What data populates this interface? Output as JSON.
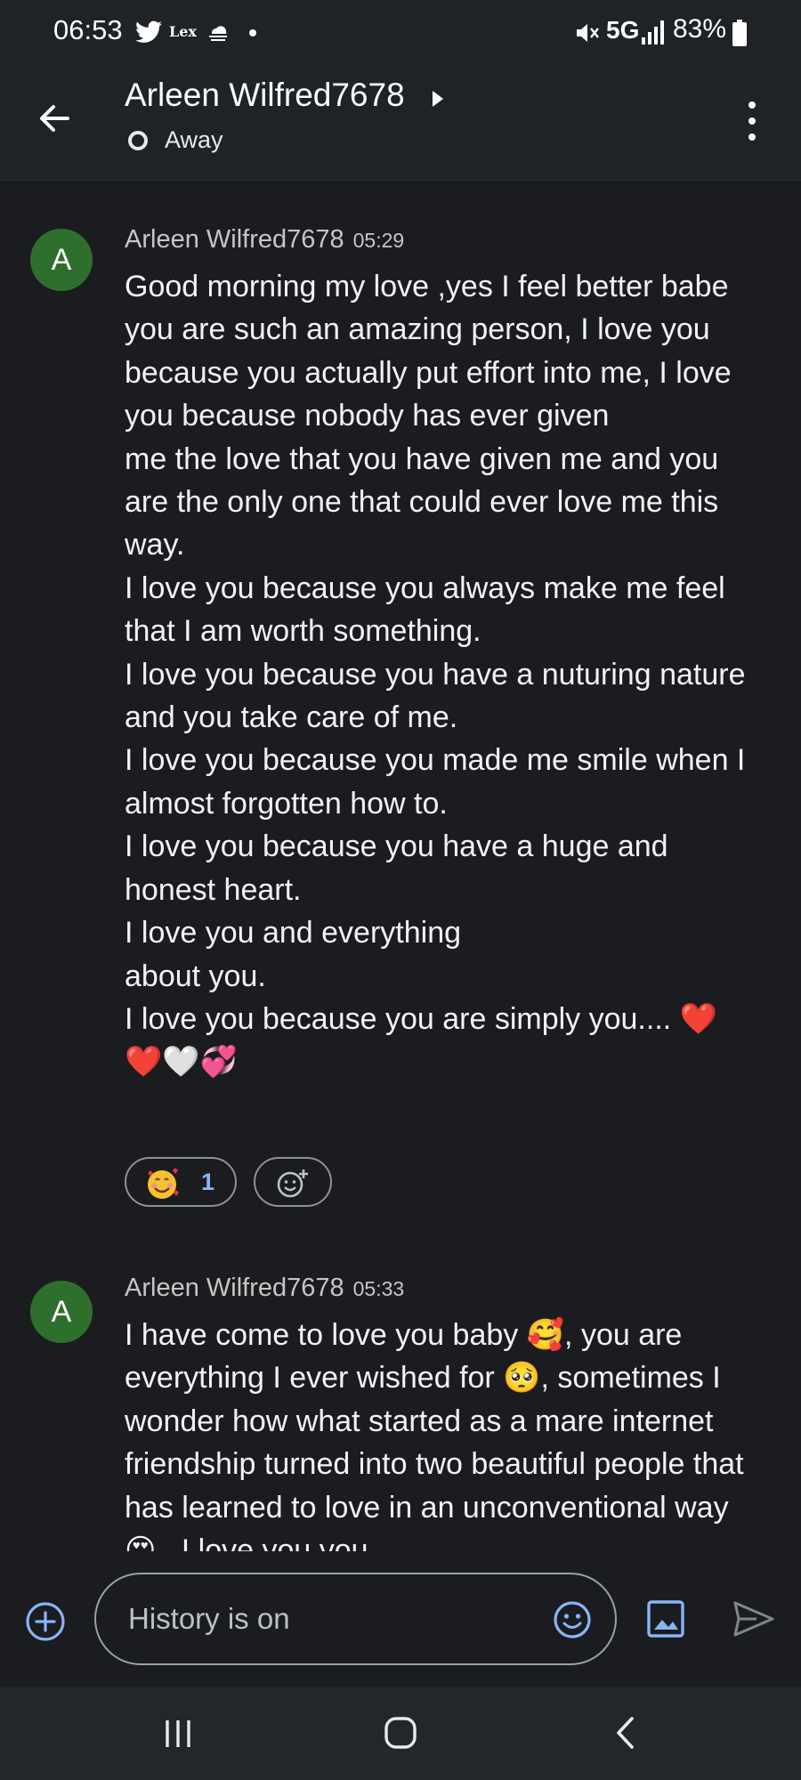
{
  "status_bar": {
    "time": "06:53",
    "carrier_text": "Lex",
    "network": "5G",
    "battery": "83%",
    "icons": [
      "twitter-bird-icon",
      "cloud-icon",
      "dot-icon",
      "mute-icon",
      "signal-icon",
      "battery-icon"
    ]
  },
  "app_bar": {
    "contact_name": "Arleen Wilfred7678",
    "presence": "Away",
    "icons": [
      "back-arrow-icon",
      "caret-right-icon",
      "presence-circle-icon",
      "overflow-menu-icon"
    ]
  },
  "messages": [
    {
      "avatar_letter": "A",
      "sender": "Arleen Wilfred7678",
      "time": "05:29",
      "text": "Good morning my love ,yes I feel better babe you are such an amazing person, I love you because you actually put effort into me, I love you because nobody has ever given\nme the love that you have given me and you are the only one that could ever love me this way.\nI love you because you always make me feel that I am worth something.\nI love you because you have a nuturing nature and you take care of me.\nI love you because you made me smile when I almost forgotten how to.\nI love you because you have a huge and honest heart.\nI love you and everything\nabout you.\nI love you because you are simply you.... ❤️ ❤️🤍💞",
      "reaction": {
        "emoji": "smiling-face-with-hearts",
        "count": "1"
      },
      "add_reaction_icon": "add-reaction-icon"
    },
    {
      "avatar_letter": "A",
      "sender": "Arleen Wilfred7678",
      "time": "05:33",
      "text": "I have come to love you baby 🥰, you are everything I ever wished for 🥺, sometimes I wonder how what started as a mare internet friendship turned into two beautiful people that has learned to love in an unconventional way 😍 . I love you you"
    }
  ],
  "compose": {
    "placeholder": "History is on",
    "icons": [
      "add-circle-icon",
      "emoji-icon",
      "image-icon",
      "send-icon"
    ]
  },
  "nav_bar": {
    "icons": [
      "recent-apps-icon",
      "home-icon",
      "nav-back-icon"
    ]
  },
  "colors": {
    "background": "#1b1c1f",
    "bar": "#1f2227",
    "avatar": "#2f6f2d",
    "accent": "#8ab4f8",
    "text": "#f1f3f4"
  }
}
